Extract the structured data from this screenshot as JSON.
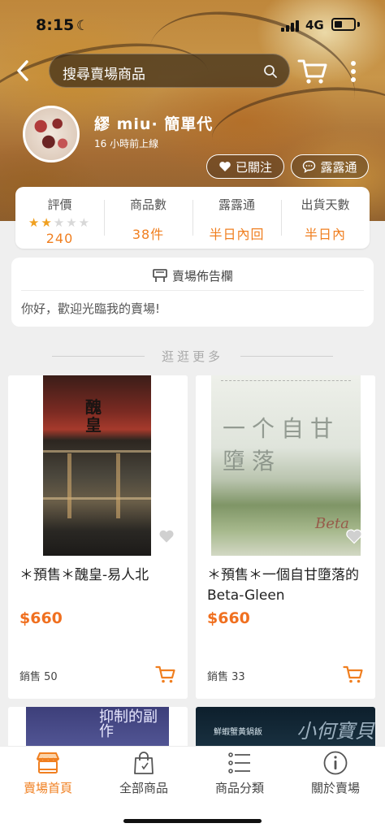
{
  "status_bar": {
    "time": "8:15",
    "network": "4G"
  },
  "search": {
    "placeholder": "搜尋賣場商品"
  },
  "shop": {
    "name": "繆 miu· 簡單代",
    "last_online": "16 小時前上線",
    "follow_label": "已關注",
    "chat_label": "露露通"
  },
  "stats": {
    "rating": {
      "label": "評價",
      "value": "240",
      "stars": 2,
      "max_stars": 5
    },
    "products": {
      "label": "商品數",
      "value": "38件"
    },
    "chat": {
      "label": "露露通",
      "value": "半日內回"
    },
    "shipping": {
      "label": "出貨天數",
      "value": "半日內"
    }
  },
  "notice": {
    "title": "賣場佈告欄",
    "text": "你好，歡迎光臨我的賣場!"
  },
  "browse_label": "逛逛更多",
  "products": [
    {
      "title": "＊預售＊醜皇-易人北",
      "price": "$660",
      "sales": "銷售 50",
      "cover_text": "醜皇"
    },
    {
      "title": "＊預售＊一個自甘墮落的Beta-Gleen",
      "price": "$660",
      "sales": "銷售 33",
      "cover_text": "一个自甘墮落",
      "cover_sign": "Beta"
    },
    {
      "cover_text": "抑制的副作"
    },
    {
      "cover_text": "鮮蝦蟹黃鍋飯",
      "cover_text2": "小何寶貝"
    }
  ],
  "tabs": [
    {
      "label": "賣場首頁",
      "icon": "store-icon",
      "active": true
    },
    {
      "label": "全部商品",
      "icon": "shopping-bag-icon",
      "active": false
    },
    {
      "label": "商品分類",
      "icon": "list-icon",
      "active": false
    },
    {
      "label": "關於賣場",
      "icon": "info-icon",
      "active": false
    }
  ],
  "colors": {
    "accent": "#f07f20",
    "price": "#f07020",
    "star": "#f0a020"
  }
}
